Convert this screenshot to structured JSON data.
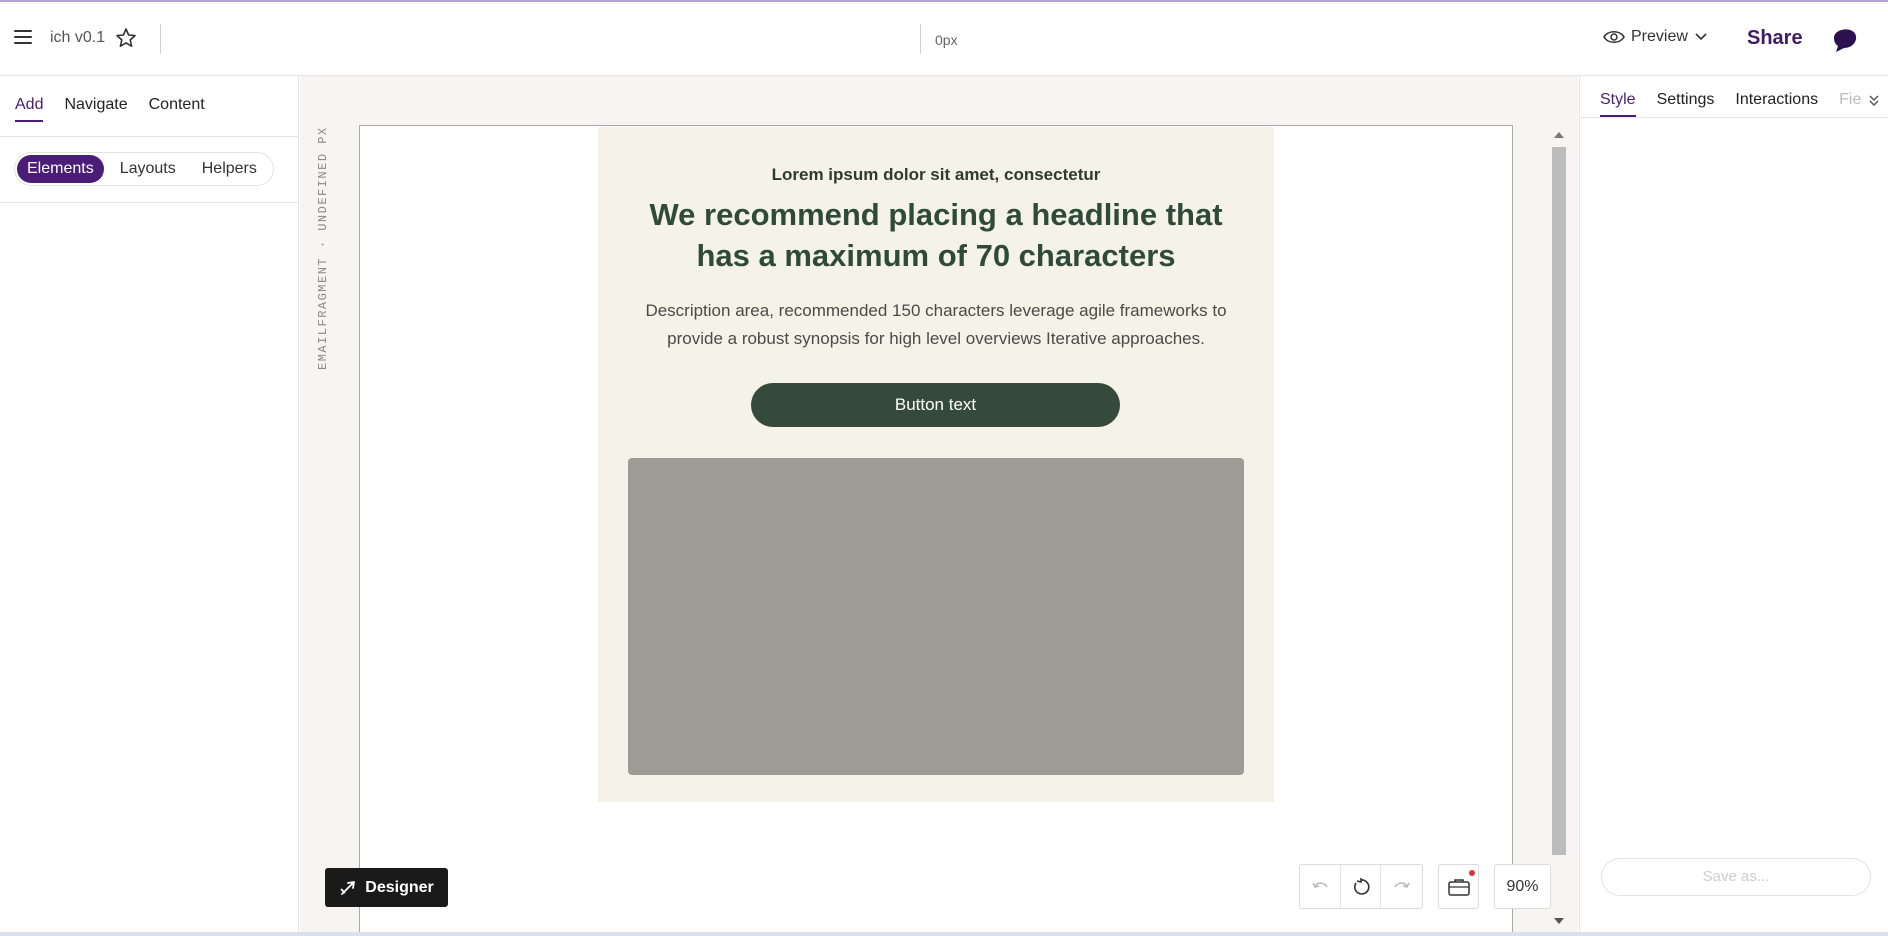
{
  "header": {
    "doc_title": "ich v0.1",
    "px_value": "0px",
    "preview_label": "Preview",
    "share_label": "Share"
  },
  "left_panel": {
    "tabs": [
      {
        "label": "Add",
        "active": true
      },
      {
        "label": "Navigate",
        "active": false
      },
      {
        "label": "Content",
        "active": false
      }
    ],
    "segments": [
      {
        "label": "Elements",
        "active": true
      },
      {
        "label": "Layouts",
        "active": false
      },
      {
        "label": "Helpers",
        "active": false
      }
    ]
  },
  "canvas": {
    "vertical_label": "EMAILFRAGMENT · UNDEFINED PX",
    "email": {
      "eyebrow": "Lorem ipsum dolor sit amet, consectetur",
      "headline": "We recommend placing a headline that has a maximum of 70 characters",
      "description": "Description area, recommended 150 characters leverage agile frameworks to provide a robust synopsis for high level overviews Iterative approaches.",
      "button_text": "Button text"
    },
    "designer_label": "Designer",
    "zoom": "90%"
  },
  "right_panel": {
    "tabs": [
      {
        "label": "Style",
        "active": true
      },
      {
        "label": "Settings",
        "active": false
      },
      {
        "label": "Interactions",
        "active": false
      },
      {
        "label": "Fie",
        "active": false
      }
    ],
    "save_as_label": "Save as..."
  },
  "colors": {
    "brand_purple": "#4b1d78",
    "email_bg": "#f5f3e7",
    "cta_bg": "#364a3c",
    "headline": "#2f4a38",
    "image_placeholder": "#9e9a95"
  },
  "icons": [
    "hamburger-icon",
    "star-icon",
    "eye-icon",
    "chevron-down-icon",
    "avatar-icon",
    "designer-icon",
    "undo-icon",
    "reset-icon",
    "redo-icon",
    "briefcase-icon",
    "double-chevron-icon"
  ]
}
